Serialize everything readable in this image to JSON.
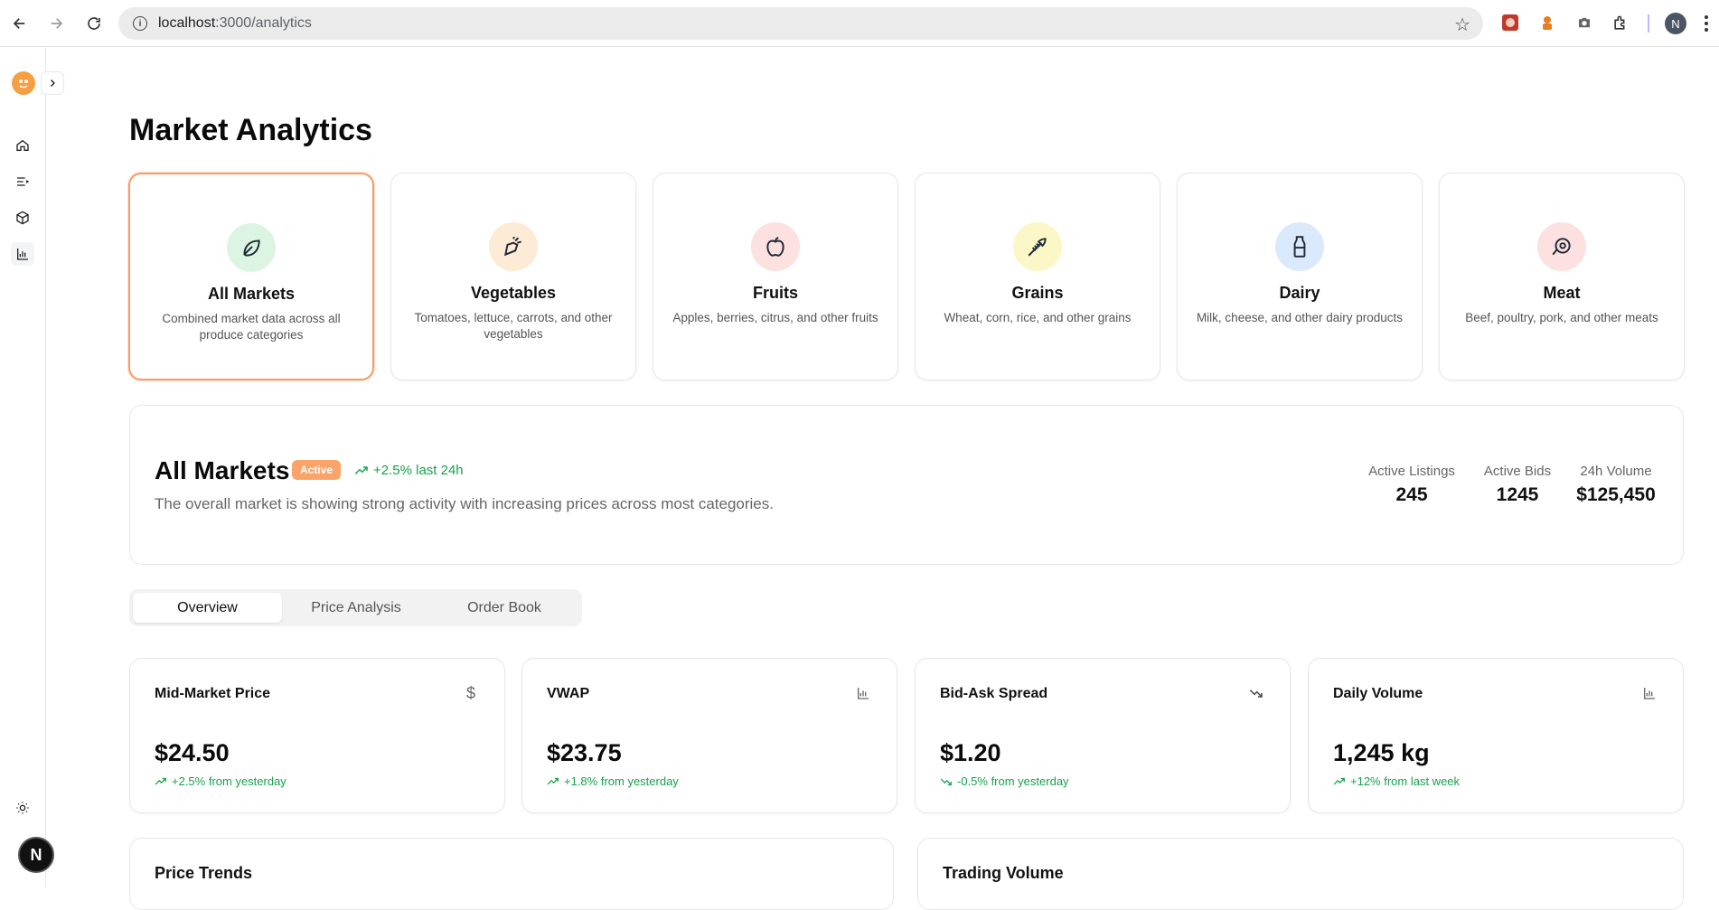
{
  "browser": {
    "url_host": "localhost",
    "url_path": ":3000/analytics",
    "profile_initial": "N"
  },
  "sidebar": {
    "items": [
      {
        "name": "home"
      },
      {
        "name": "listings"
      },
      {
        "name": "products"
      },
      {
        "name": "analytics",
        "active": true
      }
    ],
    "badge_initial": "N"
  },
  "page": {
    "title": "Market Analytics"
  },
  "categories": [
    {
      "title": "All Markets",
      "desc": "Combined market data across all produce categories",
      "icon": "leaf-icon",
      "color": "#dcf5e3",
      "selected": true
    },
    {
      "title": "Vegetables",
      "desc": "Tomatoes, lettuce, carrots, and other vegetables",
      "icon": "carrot-icon",
      "color": "#fdebd5"
    },
    {
      "title": "Fruits",
      "desc": "Apples, berries, citrus, and other fruits",
      "icon": "apple-icon",
      "color": "#fde0e0"
    },
    {
      "title": "Grains",
      "desc": "Wheat, corn, rice, and other grains",
      "icon": "wheat-icon",
      "color": "#fcf7c6"
    },
    {
      "title": "Dairy",
      "desc": "Milk, cheese, and other dairy products",
      "icon": "milk-icon",
      "color": "#dbe9fc"
    },
    {
      "title": "Meat",
      "desc": "Beef, poultry, pork, and other meats",
      "icon": "beef-icon",
      "color": "#fde0e0"
    }
  ],
  "overview": {
    "title": "All Markets",
    "badge": "Active",
    "change": "+2.5% last 24h",
    "description": "The overall market is showing strong activity with increasing prices across most categories.",
    "stats": [
      {
        "label": "Active Listings",
        "value": "245"
      },
      {
        "label": "Active Bids",
        "value": "1245"
      },
      {
        "label": "24h Volume",
        "value": "$125,450"
      }
    ]
  },
  "tabs": [
    {
      "label": "Overview",
      "active": true
    },
    {
      "label": "Price Analysis"
    },
    {
      "label": "Order Book"
    }
  ],
  "metrics": [
    {
      "title": "Mid-Market Price",
      "value": "$24.50",
      "change": "+2.5% from yesterday",
      "icon": "dollar-icon",
      "trend": "up"
    },
    {
      "title": "VWAP",
      "value": "$23.75",
      "change": "+1.8% from yesterday",
      "icon": "bar-chart-icon",
      "trend": "up"
    },
    {
      "title": "Bid-Ask Spread",
      "value": "$1.20",
      "change": "-0.5% from yesterday",
      "icon": "trending-down-icon",
      "trend": "down"
    },
    {
      "title": "Daily Volume",
      "value": "1,245 kg",
      "change": "+12% from last week",
      "icon": "bar-chart-icon",
      "trend": "up"
    }
  ],
  "bottom_cards": [
    {
      "title": "Price Trends"
    },
    {
      "title": "Trading Volume"
    }
  ],
  "colors": {
    "accent": "#f59e6c",
    "positive": "#16a34a",
    "badge": "#fba46a"
  }
}
